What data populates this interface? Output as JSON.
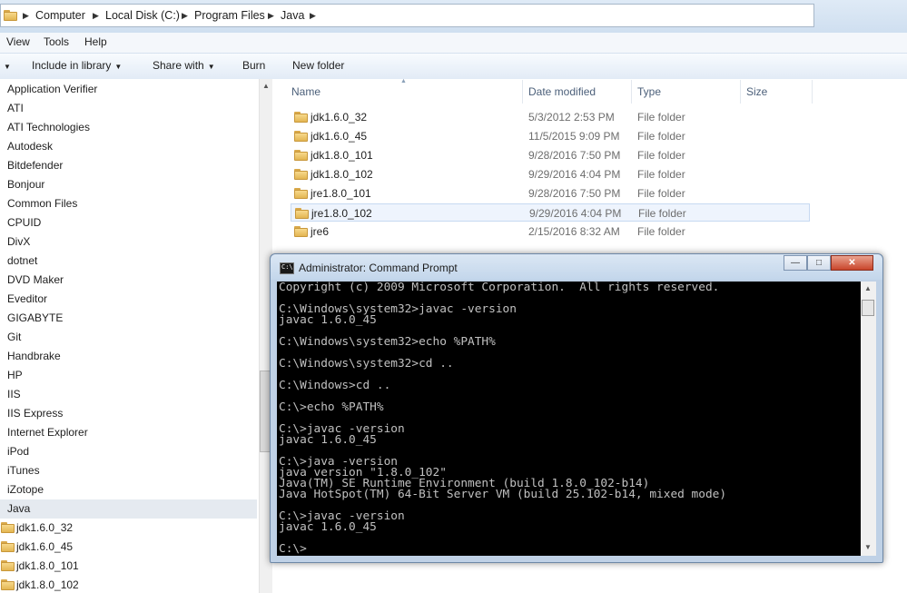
{
  "address": {
    "crumbs": [
      "Computer",
      "Local Disk (C:)",
      "Program Files",
      "Java"
    ]
  },
  "menu": [
    "View",
    "Tools",
    "Help"
  ],
  "toolbar": {
    "include_in_library": "Include in library",
    "share_with": "Share with",
    "burn": "Burn",
    "new_folder": "New folder"
  },
  "nav": {
    "items": [
      "Application Verifier",
      "ATI",
      "ATI Technologies",
      "Autodesk",
      "Bitdefender",
      "Bonjour",
      "Common Files",
      "CPUID",
      "DivX",
      "dotnet",
      "DVD Maker",
      "Eveditor",
      "GIGABYTE",
      "Git",
      "Handbrake",
      "HP",
      "IIS",
      "IIS Express",
      "Internet Explorer",
      "iPod",
      "iTunes",
      "iZotope",
      "Java"
    ],
    "selected": "Java",
    "subitems": [
      "jdk1.6.0_32",
      "jdk1.6.0_45",
      "jdk1.8.0_101",
      "jdk1.8.0_102"
    ]
  },
  "columns": {
    "name": "Name",
    "date": "Date modified",
    "type": "Type",
    "size": "Size"
  },
  "files": [
    {
      "name": "jdk1.6.0_32",
      "date": "5/3/2012 2:53 PM",
      "type": "File folder"
    },
    {
      "name": "jdk1.6.0_45",
      "date": "11/5/2015 9:09 PM",
      "type": "File folder"
    },
    {
      "name": "jdk1.8.0_101",
      "date": "9/28/2016 7:50 PM",
      "type": "File folder"
    },
    {
      "name": "jdk1.8.0_102",
      "date": "9/29/2016 4:04 PM",
      "type": "File folder"
    },
    {
      "name": "jre1.8.0_101",
      "date": "9/28/2016 7:50 PM",
      "type": "File folder"
    },
    {
      "name": "jre1.8.0_102",
      "date": "9/29/2016 4:04 PM",
      "type": "File folder"
    },
    {
      "name": "jre6",
      "date": "2/15/2016 8:32 AM",
      "type": "File folder"
    }
  ],
  "selected_file": "jre1.8.0_102",
  "cmd": {
    "title": "Administrator: Command Prompt",
    "icon_text": "C:\\",
    "lines": [
      "Copyright (c) 2009 Microsoft Corporation.  All rights reserved.",
      "",
      "C:\\Windows\\system32>javac -version",
      "javac 1.6.0_45",
      "",
      "C:\\Windows\\system32>echo %PATH%",
      "",
      "C:\\Windows\\system32>cd ..",
      "",
      "C:\\Windows>cd ..",
      "",
      "C:\\>echo %PATH%",
      "",
      "C:\\>javac -version",
      "javac 1.6.0_45",
      "",
      "C:\\>java -version",
      "java version \"1.8.0_102\"",
      "Java(TM) SE Runtime Environment (build 1.8.0_102-b14)",
      "Java HotSpot(TM) 64-Bit Server VM (build 25.102-b14, mixed mode)",
      "",
      "C:\\>javac -version",
      "javac 1.6.0_45",
      "",
      "C:\\>"
    ]
  }
}
